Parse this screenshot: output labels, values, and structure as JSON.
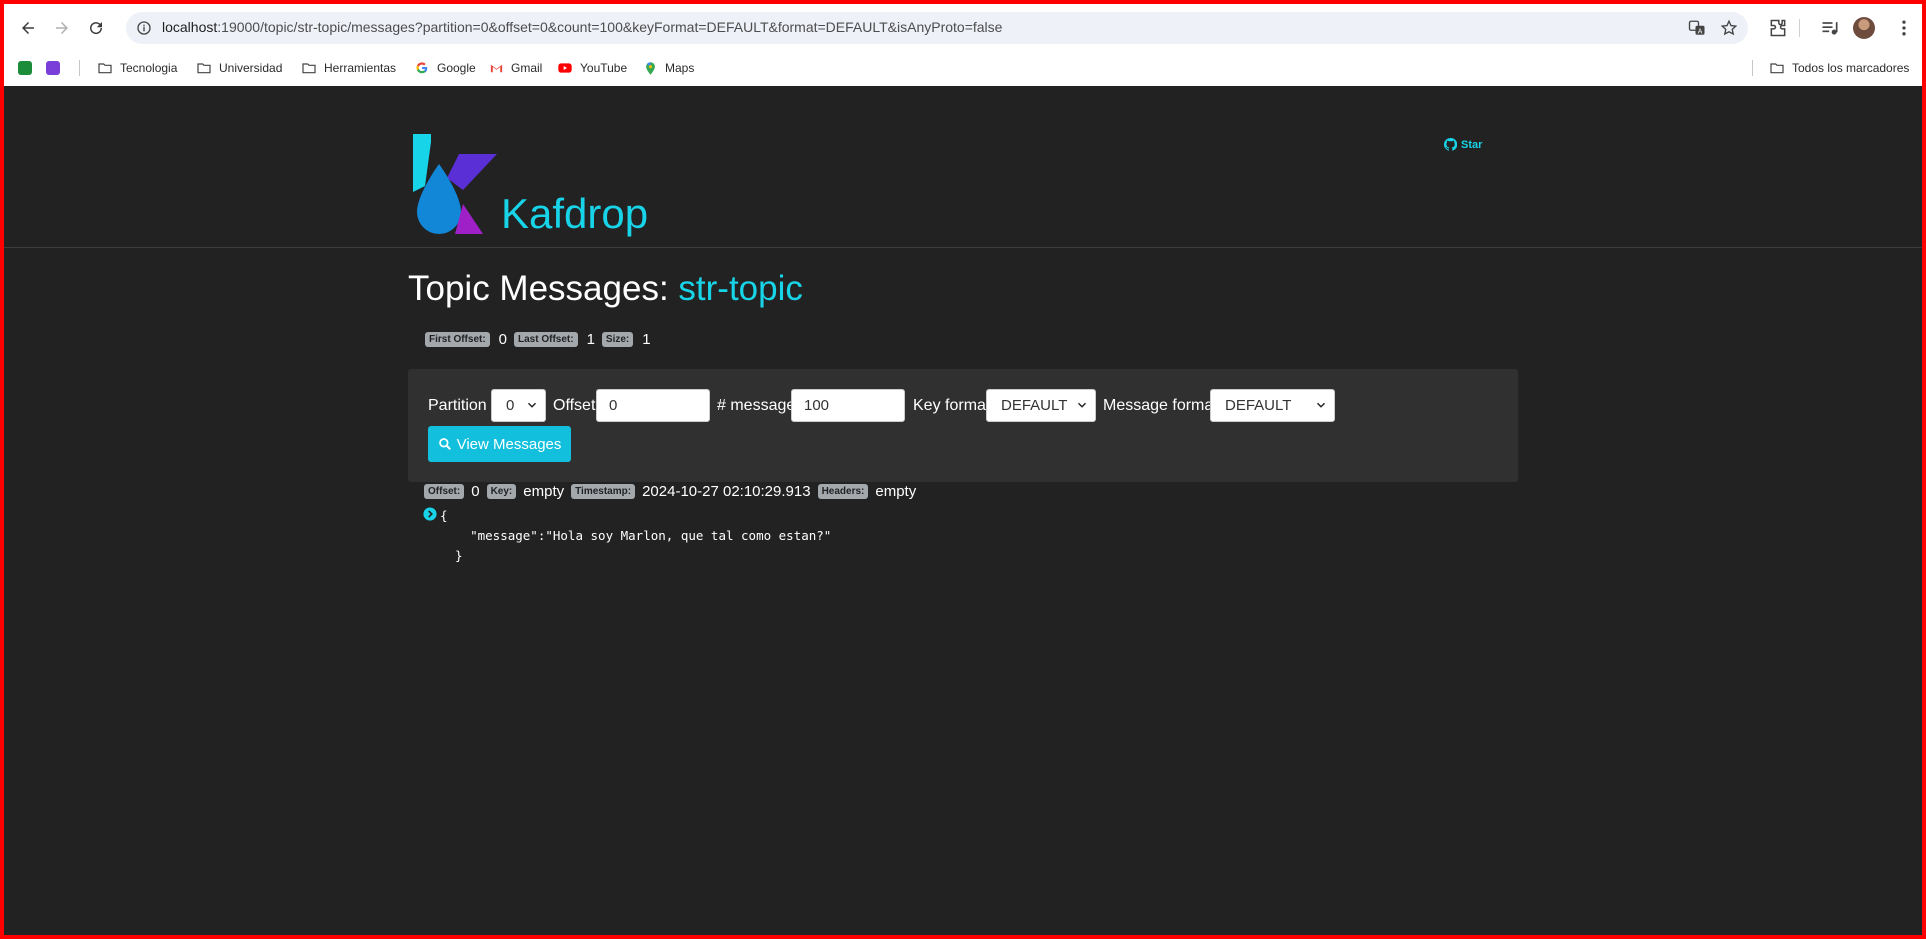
{
  "browser": {
    "url_host": "localhost",
    "url_rest": ":19000/topic/str-topic/messages?partition=0&offset=0&count=100&keyFormat=DEFAULT&format=DEFAULT&isAnyProto=false",
    "bookmarks": [
      {
        "label": "Tecnologia",
        "icon": "folder-icon"
      },
      {
        "label": "Universidad",
        "icon": "folder-icon"
      },
      {
        "label": "Herramientas",
        "icon": "folder-icon"
      },
      {
        "label": "Google",
        "icon": "google-icon"
      },
      {
        "label": "Gmail",
        "icon": "gmail-icon"
      },
      {
        "label": "YouTube",
        "icon": "youtube-icon"
      },
      {
        "label": "Maps",
        "icon": "maps-icon"
      }
    ],
    "all_bookmarks": "Todos los marcadores"
  },
  "app": {
    "brand": "Kafdrop",
    "star_label": "Star",
    "accent": "#18d4e8"
  },
  "page": {
    "title_prefix": "Topic Messages: ",
    "topic_name": "str-topic",
    "first_offset_label": "First Offset:",
    "first_offset": "0",
    "last_offset_label": "Last Offset:",
    "last_offset": "1",
    "size_label": "Size:",
    "size": "1"
  },
  "filter": {
    "partition_label": "Partition",
    "partition_value": "0",
    "offset_label": "Offset",
    "offset_value": "0",
    "messages_label": "# messages",
    "messages_value": "100",
    "key_format_label": "Key format",
    "key_format_value": "DEFAULT",
    "message_format_label": "Message format",
    "message_format_value": "DEFAULT",
    "view_button": "View Messages"
  },
  "message": {
    "offset_label": "Offset:",
    "offset": "0",
    "key_label": "Key:",
    "key": "empty",
    "timestamp_label": "Timestamp:",
    "timestamp": "2024-10-27 02:10:29.913",
    "headers_label": "Headers:",
    "headers": "empty",
    "body_line1": "{",
    "body_line2": "    \"message\":\"Hola soy Marlon, que tal como estan?\"",
    "body_line3": "  }"
  }
}
